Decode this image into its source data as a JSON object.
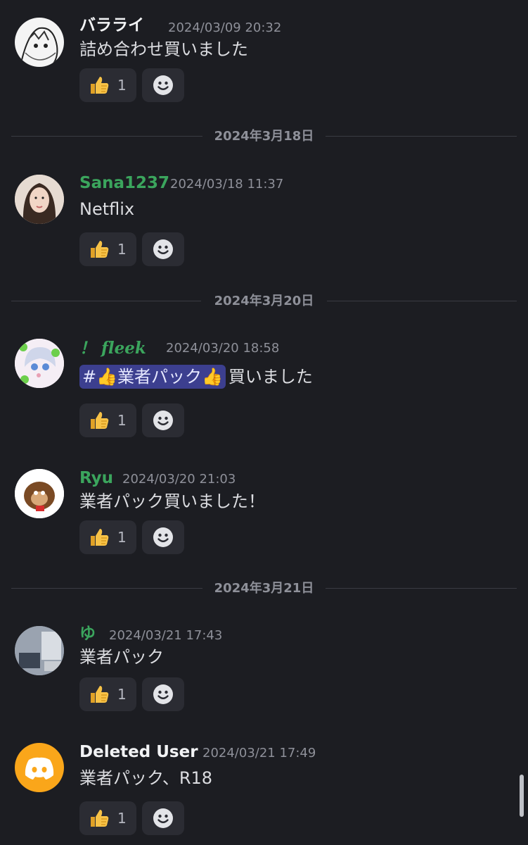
{
  "colors": {
    "background": "#1c1d22",
    "username_green": "#3ba55d",
    "username_white": "#f2f3f5",
    "mention_bg": "#3c3f8f"
  },
  "separators": [
    "2024年3月18日",
    "2024年3月20日",
    "2024年3月21日"
  ],
  "messages": [
    {
      "user": "バラライ",
      "time": "2024/03/09 20:32",
      "text": "詰め合わせ買いました",
      "reaction_count": "1",
      "reaction_icon": "thumbs-up-icon"
    },
    {
      "user": "Sana1237",
      "time": "2024/03/18 11:37",
      "text": "Netflix",
      "reaction_count": "1",
      "reaction_icon": "thumbs-up-icon"
    },
    {
      "user": "！ 𝒇𝒍𝒆𝒆𝒌",
      "time": "2024/03/20 18:58",
      "mention": "#👍業者パック👍",
      "text": "買いました",
      "reaction_count": "1",
      "reaction_icon": "thumbs-up-icon"
    },
    {
      "user": "Ryu",
      "time": "2024/03/20 21:03",
      "text": "業者パック買いました！",
      "reaction_count": "1",
      "reaction_icon": "thumbs-up-icon"
    },
    {
      "user": "ゆ",
      "time": "2024/03/21 17:43",
      "text": "業者パック",
      "reaction_count": "1",
      "reaction_icon": "thumbs-up-icon"
    },
    {
      "user": "Deleted User",
      "time": "2024/03/21 17:49",
      "text": "業者パック、R18",
      "reaction_count": "1",
      "reaction_icon": "thumbs-up-icon"
    }
  ]
}
